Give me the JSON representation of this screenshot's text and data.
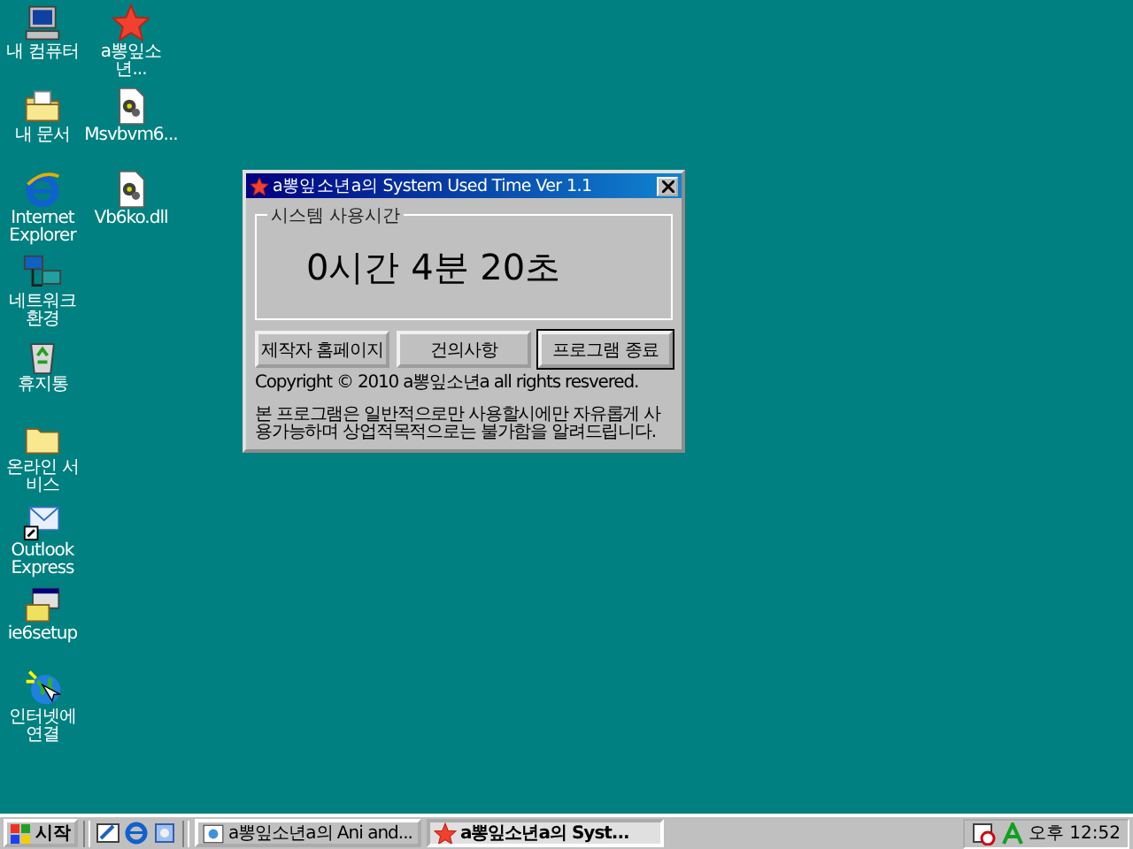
{
  "desktop": {
    "columns": [
      [
        {
          "label": "내 컴퓨터",
          "kind": "computer"
        },
        {
          "label": "내 문서",
          "kind": "docs"
        },
        {
          "label": "Internet Explorer",
          "kind": "ie"
        },
        {
          "label": "네트워크 환경",
          "kind": "network"
        },
        {
          "label": "휴지통",
          "kind": "recycle"
        },
        {
          "label": "온라인 서비스",
          "kind": "folder"
        },
        {
          "label": "Outlook Express",
          "kind": "outlook"
        },
        {
          "label": "ie6setup",
          "kind": "setup"
        },
        {
          "label": "인터넷에 연결",
          "kind": "globe"
        }
      ],
      [
        {
          "label": "a뽕잎소년...",
          "kind": "star"
        },
        {
          "label": "Msvbvm6...",
          "kind": "dll"
        },
        {
          "label": "Vb6ko.dll",
          "kind": "dll"
        }
      ]
    ]
  },
  "dialog": {
    "title": "a뽕잎소년a의 System Used Time Ver 1.1",
    "group_label": "시스템 사용시간",
    "elapsed": "0시간 4분 20초",
    "buttons": [
      {
        "label": "제작자 홈페이지",
        "default": false
      },
      {
        "label": "건의사항",
        "default": false
      },
      {
        "label": "프로그램 종료",
        "default": true
      }
    ],
    "copyright": "Copyright © 2010 a뽕잎소년a all rights resvered.",
    "notice": "본 프로그램은 일반적으로만 사용할시에만 자유롭게 사용가능하며 상업적목적으로는 불가함을 알려드립니다."
  },
  "taskbar": {
    "start_label": "시작",
    "tasks": [
      {
        "label": "a뽕잎소년a의 Ani and...",
        "selected": false,
        "kind": "app"
      },
      {
        "label": "a뽕잎소년a의 Syst...",
        "selected": true,
        "kind": "star"
      }
    ],
    "clock": "오후 12:52"
  }
}
